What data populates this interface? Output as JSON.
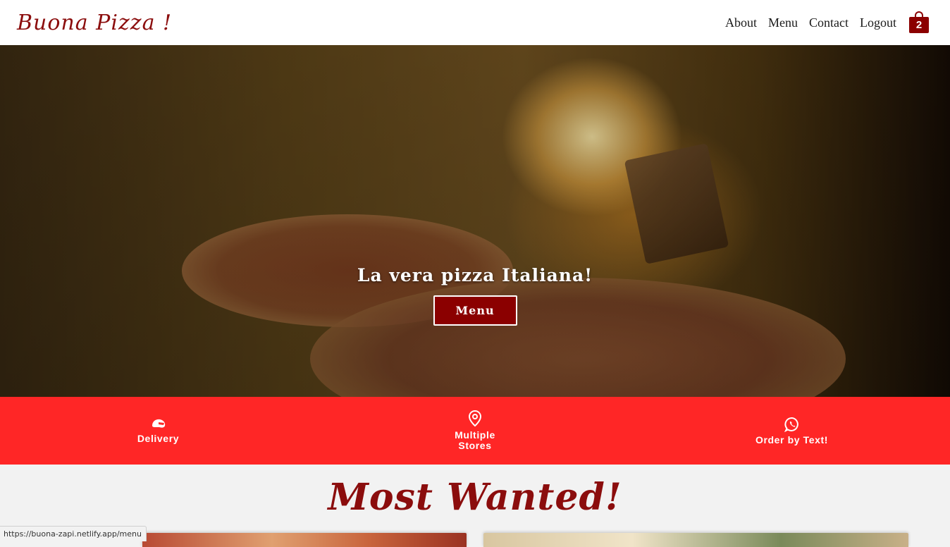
{
  "navbar": {
    "brand": "Buona Pizza !",
    "links": [
      "About",
      "Menu",
      "Contact",
      "Logout"
    ],
    "cart_count": "2",
    "cart_icon": "shopping-bag-icon"
  },
  "hero": {
    "title": "La vera pizza Italiana!",
    "button_label": "Menu"
  },
  "features": [
    {
      "icon": "helmet-icon",
      "label": "Delivery"
    },
    {
      "icon": "location-pin-icon",
      "label_line1": "Multiple",
      "label_line2": "Stores"
    },
    {
      "icon": "whatsapp-icon",
      "label": "Order by Text!"
    }
  ],
  "most_wanted": {
    "title": "Most Wanted!"
  },
  "status_bar": {
    "url": "https://buona-zapi.netlify.app/menu"
  },
  "colors": {
    "brand": "#8b0d0d",
    "accent_red": "#ff2626",
    "button_bg": "#8b0000"
  }
}
